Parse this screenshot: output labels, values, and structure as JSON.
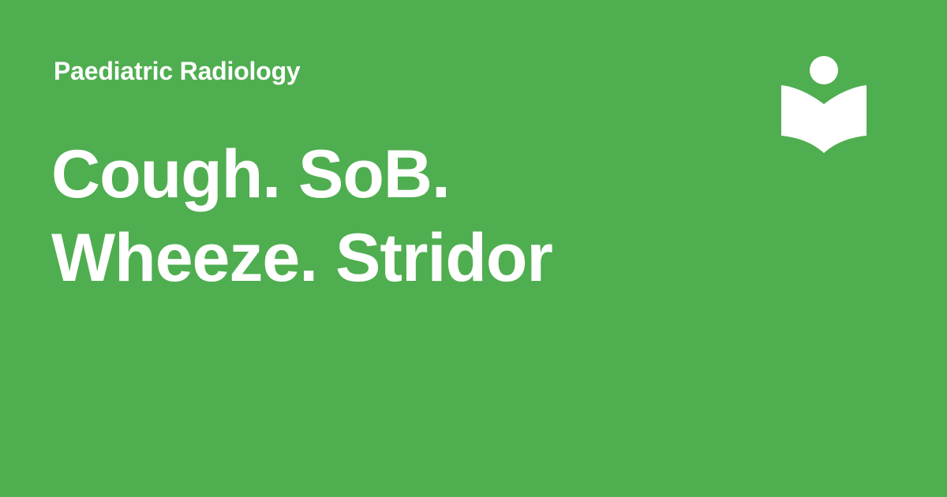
{
  "card": {
    "category": "Paediatric Radiology",
    "title_lines": [
      "Cough. SoB.",
      "Wheeze. Stridor"
    ],
    "logo_icon": "reader-book-icon",
    "colors": {
      "background": "#4fae50",
      "text": "#ffffff"
    }
  }
}
